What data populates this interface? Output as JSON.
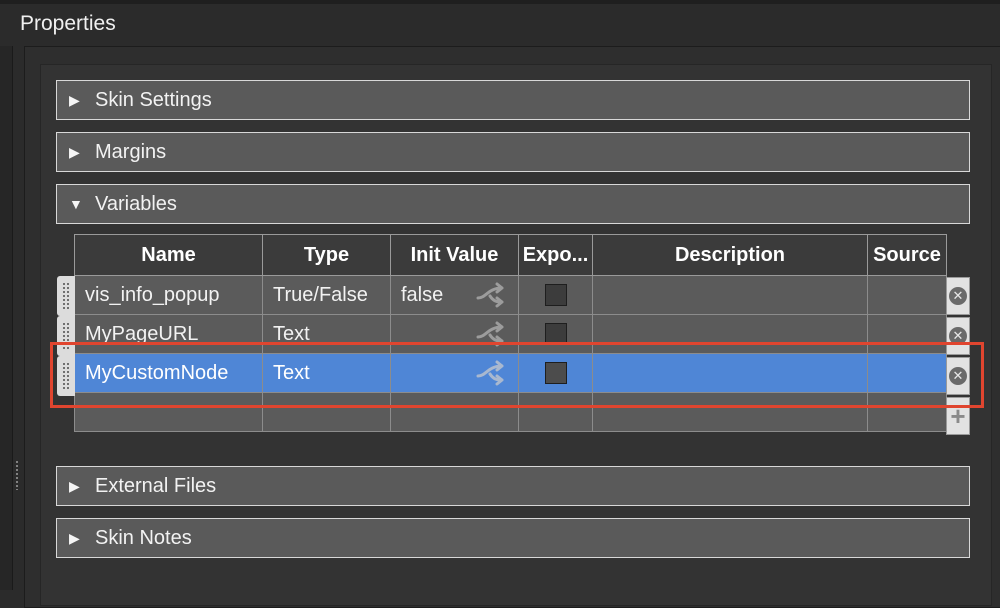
{
  "panel": {
    "title": "Properties"
  },
  "sections": {
    "skin_settings": "Skin Settings",
    "margins": "Margins",
    "variables": "Variables",
    "external_files": "External Files",
    "skin_notes": "Skin Notes"
  },
  "table": {
    "headers": [
      "Name",
      "Type",
      "Init Value",
      "Expo...",
      "Description",
      "Source"
    ],
    "rows": [
      {
        "name": "vis_info_popup",
        "type": "True/False",
        "init": "false"
      },
      {
        "name": "MyPageURL",
        "type": "Text",
        "init": ""
      },
      {
        "name": "MyCustomNode",
        "type": "Text",
        "init": ""
      }
    ]
  },
  "icons": [
    "expand-triangle-icon",
    "collapse-triangle-icon",
    "share-link-icon",
    "remove-row-icon",
    "add-row-icon",
    "drag-handle-icon"
  ],
  "colors": {
    "selection": "#4f86d6",
    "highlight": "#e0452f",
    "header_bar": "#5a5a5a"
  }
}
